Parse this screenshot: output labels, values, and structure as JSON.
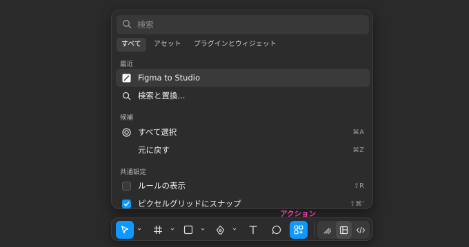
{
  "search": {
    "placeholder": "検索"
  },
  "tabs": [
    {
      "label": "すべて",
      "active": true
    },
    {
      "label": "アセット",
      "active": false
    },
    {
      "label": "プラグインとウィジェット",
      "active": false
    }
  ],
  "sections": {
    "recent": "最近",
    "suggestions": "候補",
    "common": "共通設定"
  },
  "recent_items": [
    {
      "label": "Figma to Studio",
      "icon": "plugin-slash-icon"
    },
    {
      "label": "検索と置換...",
      "icon": "search-icon"
    }
  ],
  "suggestion_items": [
    {
      "label": "すべて選択",
      "icon": "target-icon",
      "shortcut": "⌘A"
    },
    {
      "label": "元に戻す",
      "icon": "",
      "shortcut": "⌘Z"
    }
  ],
  "common_items": [
    {
      "label": "ルールの表示",
      "checked": false,
      "shortcut": "⇧R"
    },
    {
      "label": "ピクセルグリッドにスナップ",
      "checked": true,
      "shortcut": "⇧⌘'"
    }
  ],
  "annotation": {
    "label": "アクション",
    "color": "#ff3fb0"
  },
  "toolbar": {
    "tools": [
      "move-tool-icon",
      "frame-tool-icon",
      "rectangle-tool-icon",
      "pen-tool-icon",
      "text-tool-icon",
      "comment-tool-icon",
      "actions-icon"
    ],
    "mode_switch": [
      "draw-mode-icon",
      "design-mode-icon",
      "dev-mode-icon"
    ],
    "accent": "#0d99ff"
  }
}
